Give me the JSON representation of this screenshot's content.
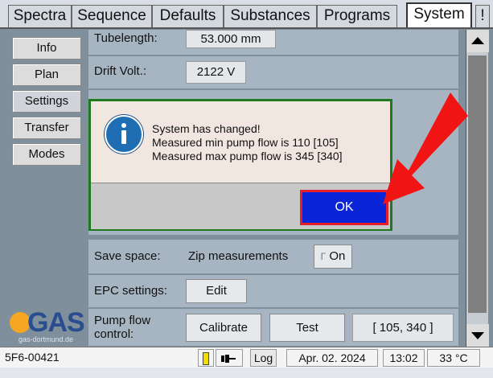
{
  "tabs": [
    {
      "label": "Spectra"
    },
    {
      "label": "Sequence"
    },
    {
      "label": "Defaults"
    },
    {
      "label": "Substances"
    },
    {
      "label": "Programs"
    },
    {
      "label": "System"
    },
    {
      "label": "!"
    }
  ],
  "nav": [
    "Info",
    "Plan",
    "Settings",
    "Transfer",
    "Modes"
  ],
  "rows": {
    "tubelength": {
      "label": "Tubelength:",
      "value": "53.000 mm"
    },
    "drift": {
      "label": "Drift Volt.:",
      "value": "2122 V"
    },
    "save_space": {
      "label": "Save space:",
      "option": "Zip measurements",
      "toggle": "On",
      "toggle_mark": "Γ"
    },
    "epc": {
      "label": "EPC settings:",
      "button": "Edit"
    },
    "pump": {
      "label_line1": "Pump flow",
      "label_line2": "control:",
      "calibrate": "Calibrate",
      "test": "Test",
      "range": "[ 105, 340 ]"
    }
  },
  "logo": {
    "text": "GAS",
    "subtitle": "gas-dortmund.de",
    "color": "#f5a623",
    "text_color": "#2a4d8f"
  },
  "dialog": {
    "line1": "System has changed!",
    "line2": "Measured min pump flow is 110 [105]",
    "line3": "Measured max pump flow is 345 [340]",
    "ok": "OK",
    "icon": "info-icon"
  },
  "annotation": {
    "arrow_color": "#f01414"
  },
  "status": {
    "device_id": "5F6-00421",
    "log": "Log",
    "date": "Apr. 02. 2024",
    "time": "13:02",
    "temperature": "33 °C"
  }
}
